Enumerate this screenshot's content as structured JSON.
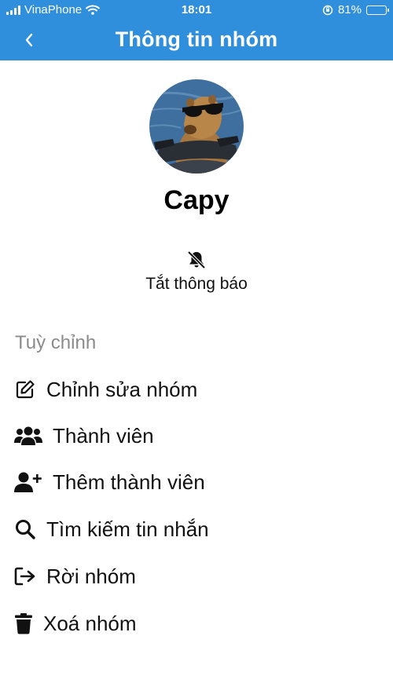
{
  "status_bar": {
    "carrier": "VinaPhone",
    "time": "18:01",
    "battery_text": "81%",
    "battery_level": 0.81
  },
  "header": {
    "title": "Thông tin nhóm",
    "back_icon": "chevron-left-icon",
    "color": "#2f8fdc"
  },
  "group": {
    "name": "Capy"
  },
  "mute": {
    "label": "Tắt thông báo",
    "icon": "bell-slash-icon"
  },
  "section": {
    "label": "Tuỳ chỉnh"
  },
  "menu": [
    {
      "label": "Chỉnh sửa nhóm",
      "icon": "edit-icon"
    },
    {
      "label": "Thành viên",
      "icon": "users-icon"
    },
    {
      "label": "Thêm thành viên",
      "icon": "user-plus-icon"
    },
    {
      "label": "Tìm kiếm tin nhắn",
      "icon": "search-icon"
    },
    {
      "label": "Rời nhóm",
      "icon": "sign-out-icon"
    },
    {
      "label": "Xoá nhóm",
      "icon": "trash-icon"
    }
  ]
}
